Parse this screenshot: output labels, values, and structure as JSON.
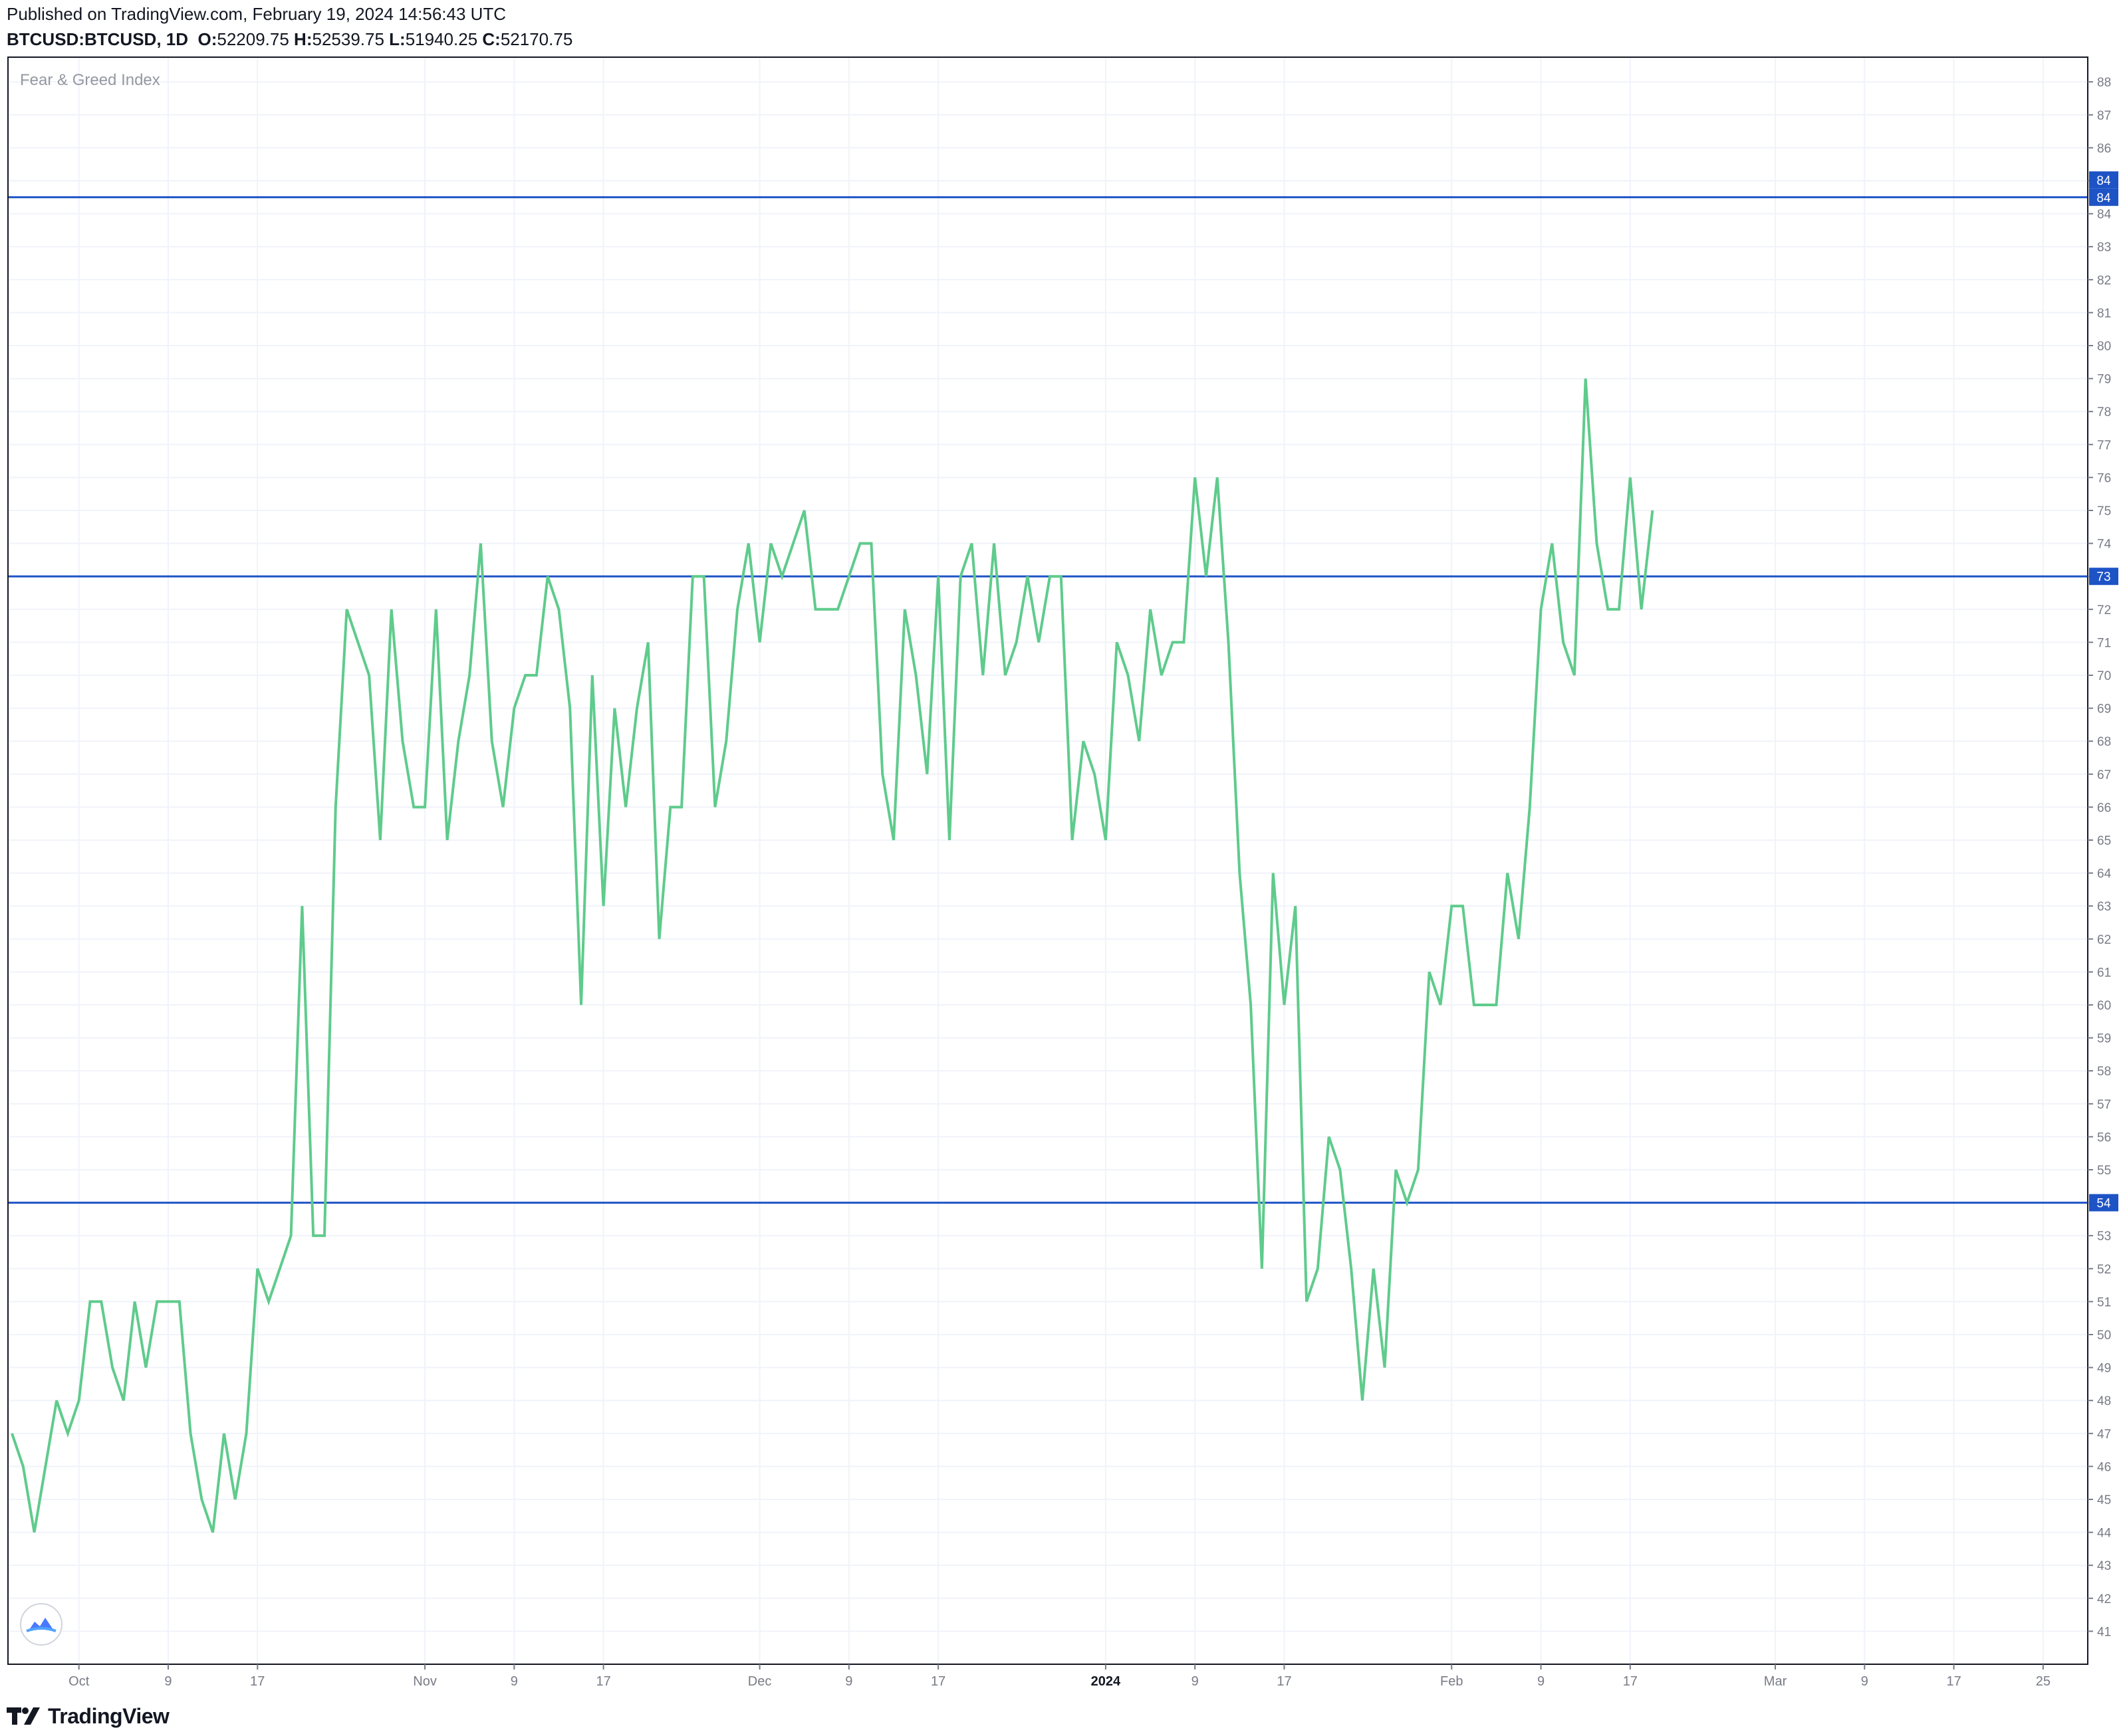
{
  "header": {
    "published": "Published on TradingView.com, February 19, 2024 14:56:43 UTC",
    "symbol": "BTCUSD:BTCUSD",
    "interval": ", 1D",
    "o_label": "O:",
    "o_value": "52209.75",
    "h_label": "H:",
    "h_value": "52539.75",
    "l_label": "L:",
    "l_value": "51940.25",
    "c_label": "C:",
    "c_value": "52170.75"
  },
  "footer": {
    "brand": "TradingView"
  },
  "colors": {
    "series": "#5fcb8c",
    "hline": "#1e53c6",
    "badge": "#1e53c6",
    "grid": "#f0f3fa",
    "axis_text": "#787b86",
    "border": "#131722"
  },
  "chart_data": {
    "type": "line",
    "title": "Fear & Greed Index",
    "xlabel": "",
    "ylabel": "",
    "ylim": [
      40.0,
      88.75
    ],
    "grid": true,
    "y_ticks": [
      41,
      42,
      43,
      44,
      45,
      46,
      47,
      48,
      49,
      50,
      51,
      52,
      53,
      54,
      55,
      56,
      57,
      58,
      59,
      60,
      61,
      62,
      63,
      64,
      65,
      66,
      67,
      68,
      69,
      70,
      71,
      72,
      73,
      74,
      75,
      76,
      77,
      78,
      79,
      80,
      81,
      82,
      83,
      84,
      85,
      86,
      87,
      88
    ],
    "x_ticks": [
      {
        "label": "Oct",
        "day": 6
      },
      {
        "label": "9",
        "day": 14
      },
      {
        "label": "17",
        "day": 22
      },
      {
        "label": "Nov",
        "day": 37
      },
      {
        "label": "9",
        "day": 45
      },
      {
        "label": "17",
        "day": 53
      },
      {
        "label": "Dec",
        "day": 67
      },
      {
        "label": "9",
        "day": 75
      },
      {
        "label": "17",
        "day": 83
      },
      {
        "label": "2024",
        "day": 98,
        "bold": true
      },
      {
        "label": "9",
        "day": 106
      },
      {
        "label": "17",
        "day": 114
      },
      {
        "label": "Feb",
        "day": 129
      },
      {
        "label": "9",
        "day": 137
      },
      {
        "label": "17",
        "day": 145
      },
      {
        "label": "Mar",
        "day": 158
      },
      {
        "label": "9",
        "day": 166
      },
      {
        "label": "17",
        "day": 174
      },
      {
        "label": "25",
        "day": 182
      }
    ],
    "x_range_days": [
      0,
      186
    ],
    "horizontal_lines": [
      {
        "value": 84.5,
        "label": "84"
      },
      {
        "value": 73.0,
        "label": "73"
      },
      {
        "value": 54.0,
        "label": "54"
      }
    ],
    "series": [
      {
        "name": "",
        "start_date": "Sep 25, 2023",
        "values": [
          47,
          46,
          44,
          46,
          48,
          47,
          48,
          51,
          51,
          49,
          48,
          51,
          49,
          51,
          51,
          51,
          47,
          45,
          44,
          47,
          45,
          47,
          52,
          51,
          52,
          53,
          63,
          53,
          53,
          66,
          72,
          71,
          70,
          65,
          72,
          68,
          66,
          66,
          72,
          65,
          68,
          70,
          74,
          68,
          66,
          69,
          70,
          70,
          73,
          72,
          69,
          60,
          70,
          63,
          69,
          66,
          69,
          71,
          62,
          66,
          66,
          73,
          73,
          66,
          68,
          72,
          74,
          71,
          74,
          73,
          74,
          75,
          72,
          72,
          72,
          73,
          74,
          74,
          67,
          65,
          72,
          70,
          67,
          73,
          65,
          73,
          74,
          70,
          74,
          70,
          71,
          73,
          71,
          73,
          73,
          65,
          68,
          67,
          65,
          71,
          70,
          68,
          72,
          70,
          71,
          71,
          76,
          73,
          76,
          71,
          64,
          60,
          52,
          64,
          60,
          63,
          51,
          52,
          56,
          55,
          52,
          48,
          52,
          49,
          55,
          54,
          55,
          61,
          60,
          63,
          63,
          60,
          60,
          60,
          64,
          62,
          66,
          72,
          74,
          71,
          70,
          79,
          74,
          72,
          72,
          76,
          72,
          75
        ]
      }
    ]
  }
}
